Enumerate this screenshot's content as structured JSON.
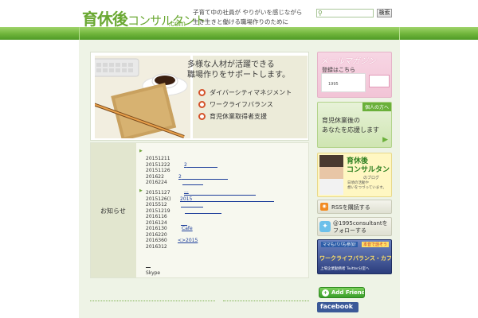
{
  "header": {
    "logo_main": "育休後",
    "logo_kana": "コンサルタント",
    "logo_sub": ".com",
    "tagline": [
      "子育て中の社員が やりがいを感じながら",
      "生き生きと働ける職場作りのために"
    ],
    "search_placeholder": "",
    "search_button": "検索"
  },
  "hero": {
    "title_lines": [
      "多様な人材が活躍できる",
      "職場作りをサポートします。"
    ],
    "items": [
      "ダイバーシティマネジメント",
      "ワークライフバランス",
      "育児休業取得者支援"
    ]
  },
  "news": {
    "label": "お知らせ",
    "group1": [
      {
        "date": "20151211",
        "link": ""
      },
      {
        "date": "20151222",
        "link": "2"
      },
      {
        "date": "20151126",
        "link": ""
      },
      {
        "date": "201622",
        "link": "2"
      },
      {
        "date": "2016224",
        "link": ""
      }
    ],
    "group2": [
      {
        "date": "20151127",
        "link": "..."
      },
      {
        "date": "2015126()",
        "link": "2015"
      },
      {
        "date": "2015512",
        "link": ""
      },
      {
        "date": "20151219",
        "link": ""
      },
      {
        "date": "2016116",
        "link": ""
      },
      {
        "date": "2016124",
        "link": ""
      },
      {
        "date": "2016130",
        "link": "Cafe"
      },
      {
        "date": "2016220",
        "link": ""
      },
      {
        "date": "2016360",
        "link": "<>2015"
      },
      {
        "date": "2016312",
        "link": ""
      }
    ],
    "footer": "Skype"
  },
  "sidebar": {
    "mailmag_title": "メールマガジン",
    "mailmag_register": "登録はこちら",
    "mailmag_number": "1995",
    "support_tag": "個人の方へ",
    "support_lines": [
      "育児休業後の",
      "あなたを応援します"
    ],
    "blog_lines": [
      "育休後",
      "コンサルタント"
    ],
    "blog_sub": "のブログ",
    "blog_desc": [
      "日頃の活動や",
      "想いをつづっています。"
    ],
    "rss_label": "RSSを購読する",
    "twitter_lines": [
      "@1995consultantを",
      "フォローする"
    ],
    "cafe_top": "ママもパパも参加!",
    "cafe_badge": "本音で話そう",
    "cafe_main": "ワークライフバランス・カフェ",
    "cafe_sub": "上場企業勤務者 Twitter分室へ",
    "add_friends": "Add Friends",
    "facebook": "facebook"
  },
  "colors": {
    "brand_green": "#6aa832",
    "nav_green": "#6fb43a",
    "link_blue": "#1c3d9a",
    "accent_red": "#d4532b"
  }
}
